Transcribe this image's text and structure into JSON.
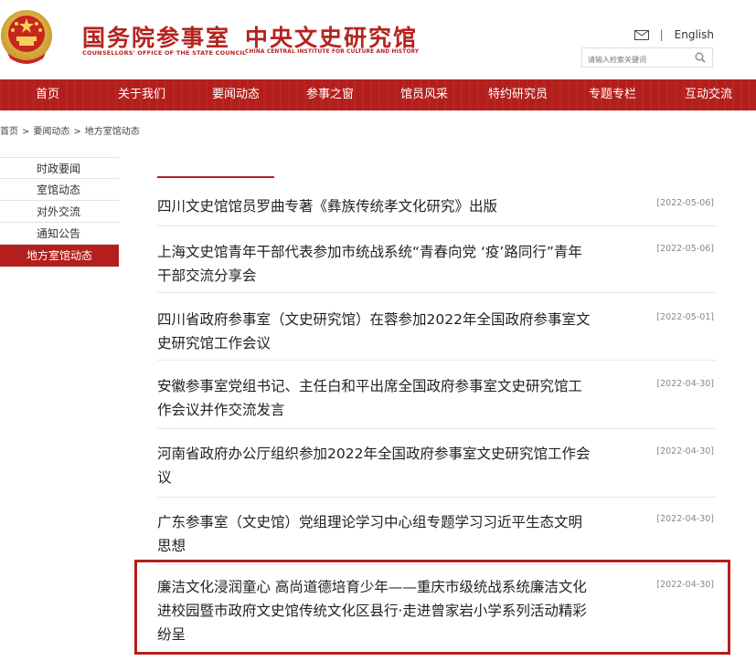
{
  "header": {
    "org1_cn": "国务院参事室",
    "org1_en": "COUNSELLORS' OFFICE OF THE STATE COUNCIL",
    "org2_cn": "中央文史研究馆",
    "org2_en": "CHINA CENTRAL INSTITUTE FOR CULTURE AND HISTORY",
    "mail_icon": "mail-icon",
    "language_link": "English",
    "search_placeholder": "请输入检索关键词",
    "search_icon": "search-icon"
  },
  "nav": {
    "items": [
      "首页",
      "关于我们",
      "要闻动态",
      "参事之窗",
      "馆员风采",
      "特约研究员",
      "专题专栏",
      "互动交流"
    ]
  },
  "breadcrumb": [
    "首页",
    "要闻动态",
    "地方室馆动态"
  ],
  "sidebar": {
    "items": [
      "时政要闻",
      "室馆动态",
      "对外交流",
      "通知公告",
      "地方室馆动态"
    ],
    "active_index": 4
  },
  "articles": [
    {
      "title": "四川文史馆馆员罗曲专著《彝族传统孝文化研究》出版",
      "date": "[2022-05-06]"
    },
    {
      "title": "上海文史馆青年干部代表参加市统战系统“青春向党 ‘疫’路同行”青年干部交流分享会",
      "date": "[2022-05-06]"
    },
    {
      "title": "四川省政府参事室（文史研究馆）在蓉参加2022年全国政府参事室文史研究馆工作会议",
      "date": "[2022-05-01]"
    },
    {
      "title": "安徽参事室党组书记、主任白和平出席全国政府参事室文史研究馆工作会议并作交流发言",
      "date": "[2022-04-30]"
    },
    {
      "title": "河南省政府办公厅组织参加2022年全国政府参事室文史研究馆工作会议",
      "date": "[2022-04-30]"
    },
    {
      "title": "广东参事室（文史馆）党组理论学习中心组专题学习习近平生态文明思想",
      "date": "[2022-04-30]"
    },
    {
      "title": "廉洁文化浸润童心 高尚道德培育少年——重庆市级统战系统廉洁文化进校园暨市政府文史馆传统文化区县行·走进曾家岩小学系列活动精彩纷呈",
      "date": "[2022-04-30]"
    }
  ],
  "colors": {
    "brand_red": "#b31f1c",
    "highlight_border": "#b31f1c"
  }
}
